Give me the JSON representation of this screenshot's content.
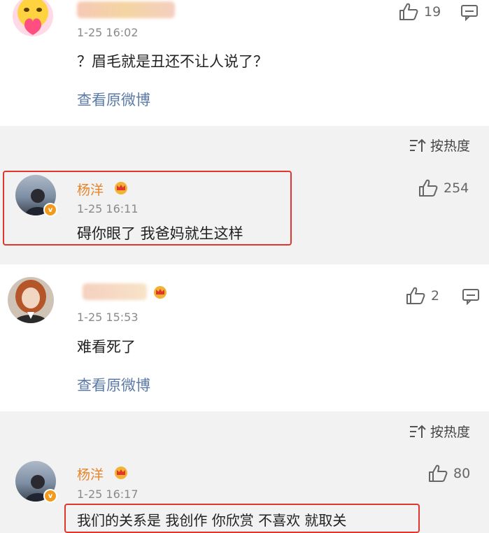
{
  "comment1": {
    "time": "1-25 16:02",
    "text": "？眉毛就是丑还不让人说了？",
    "likes": "19",
    "view_original": "查看原微博"
  },
  "sort1": {
    "label": "按热度"
  },
  "reply1": {
    "name": "杨洋",
    "time": "1-25 16:11",
    "text": "碍你眼了 我爸妈就生这样",
    "likes": "254"
  },
  "comment2": {
    "time": "1-25 15:53",
    "text": "难看死了",
    "likes": "2",
    "view_original": "查看原微博"
  },
  "sort2": {
    "label": "按热度"
  },
  "reply2": {
    "name": "杨洋",
    "time": "1-25 16:17",
    "text": "我们的关系是 我创作 你欣赏  不喜欢 就取关",
    "likes": "80"
  },
  "colors": {
    "highlight": "#e0362c",
    "name": "#e8852c",
    "link": "#5b7aa8"
  }
}
